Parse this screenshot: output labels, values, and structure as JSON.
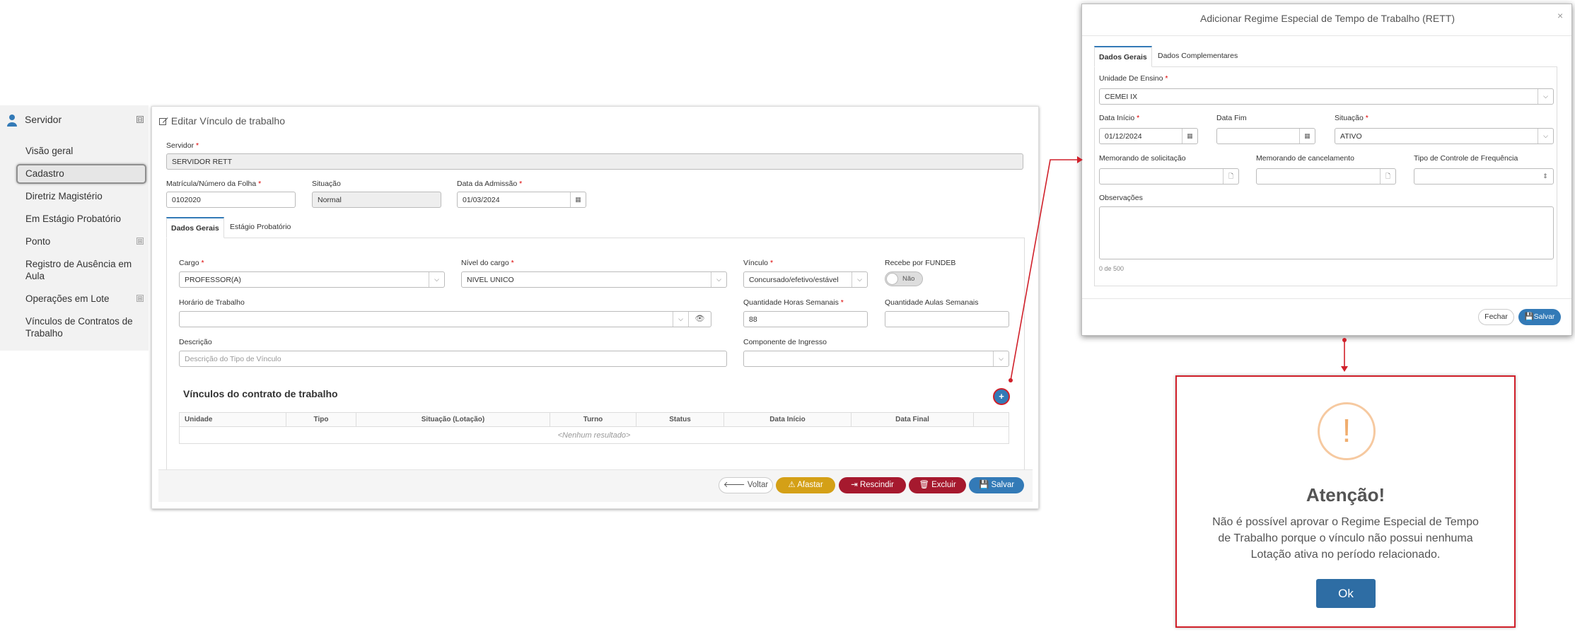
{
  "sidebar": {
    "title": "Servidor",
    "collapse_symbol": "⊟",
    "items": [
      {
        "label": "Visão geral"
      },
      {
        "label": "Cadastro"
      },
      {
        "label": "Diretriz Magistério"
      },
      {
        "label": "Em Estágio Probatório"
      },
      {
        "label": "Ponto"
      },
      {
        "label": "Registro de Ausência em Aula"
      },
      {
        "label": "Operações em Lote"
      },
      {
        "label": "Vínculos de Contratos de Trabalho"
      }
    ]
  },
  "panel": {
    "title": "Editar Vínculo de trabalho",
    "servidor": {
      "label": "Servidor",
      "value": "SERVIDOR RETT"
    },
    "matricula": {
      "label": "Matrícula/Número da Folha",
      "value": "0102020"
    },
    "situacao": {
      "label": "Situação",
      "value": "Normal"
    },
    "admissao": {
      "label": "Data da Admissão",
      "value": "01/03/2024"
    },
    "tabs": [
      "Dados Gerais",
      "Estágio Probatório"
    ],
    "cargo": {
      "label": "Cargo",
      "value": "PROFESSOR(A)"
    },
    "nivel": {
      "label": "Nível do cargo",
      "value": "NIVEL UNICO"
    },
    "vinculo": {
      "label": "Vínculo",
      "value": "Concursado/efetivo/estável"
    },
    "fundeb": {
      "label": "Recebe por FUNDEB",
      "value": "Não"
    },
    "horario": {
      "label": "Horário de Trabalho",
      "value": ""
    },
    "horas": {
      "label": "Quantidade Horas Semanais",
      "value": "88"
    },
    "aulas": {
      "label": "Quantidade Aulas Semanais",
      "value": ""
    },
    "descricao": {
      "label": "Descrição",
      "placeholder": "Descrição do Tipo de Vínculo"
    },
    "componente": {
      "label": "Componente de Ingresso",
      "value": ""
    },
    "section_title": "Vínculos do contrato de trabalho",
    "add_symbol": "+",
    "table_headers": [
      "Unidade",
      "Tipo",
      "Situação (Lotação)",
      "Turno",
      "Status",
      "Data Início",
      "Data Final"
    ],
    "empty_text": "<Nenhum resultado>",
    "buttons": {
      "voltar": "Voltar",
      "afastar": "Afastar",
      "rescindir": "Rescindir",
      "excluir": "Excluir",
      "salvar": "Salvar"
    }
  },
  "modal": {
    "title": "Adicionar Regime Especial de Tempo de Trabalho (RETT)",
    "close": "×",
    "tabs": [
      "Dados Gerais",
      "Dados Complementares"
    ],
    "unidade": {
      "label": "Unidade De Ensino",
      "value": "CEMEI IX"
    },
    "data_inicio": {
      "label": "Data Início",
      "value": "01/12/2024"
    },
    "data_fim": {
      "label": "Data Fim",
      "value": ""
    },
    "situacao": {
      "label": "Situação",
      "value": "ATIVO"
    },
    "memo_solic": {
      "label": "Memorando de solicitação",
      "value": ""
    },
    "memo_canc": {
      "label": "Memorando de cancelamento",
      "value": ""
    },
    "tipo_freq": {
      "label": "Tipo de Controle de Frequência",
      "value": ""
    },
    "observacoes": {
      "label": "Observações",
      "counter": "0 de 500"
    },
    "buttons": {
      "fechar": "Fechar",
      "salvar": "Salvar"
    }
  },
  "alert": {
    "icon_symbol": "!",
    "title": "Atenção!",
    "message": "Não é possível aprovar o Regime Especial de Tempo de Trabalho porque o vínculo não possui nenhuma Lotação ativa no período relacionado.",
    "ok": "Ok"
  },
  "colors": {
    "primary": "#337ab7",
    "warning": "#d4a017",
    "danger": "#a6192e",
    "annotation": "#d0202a"
  }
}
